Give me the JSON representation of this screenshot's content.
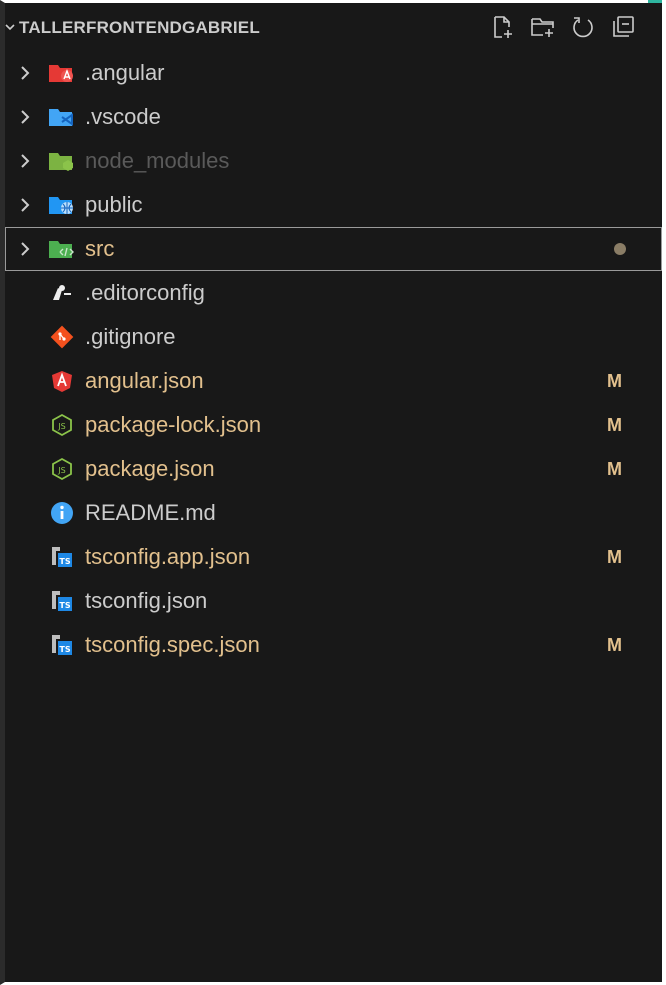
{
  "explorer": {
    "title": "TALLERFRONTENDGABRIEL",
    "actions": [
      {
        "name": "new-file-icon"
      },
      {
        "name": "new-folder-icon"
      },
      {
        "name": "refresh-icon"
      },
      {
        "name": "collapse-all-icon"
      }
    ]
  },
  "colors": {
    "background": "#181818",
    "text": "#cccccc",
    "muted": "#7f7f7f",
    "modified": "#e2c08d",
    "ignored": "#5a5a5a"
  },
  "tree": [
    {
      "label": ".angular",
      "kind": "folder",
      "icon": "angular-folder-icon",
      "color": "#cccccc"
    },
    {
      "label": ".vscode",
      "kind": "folder",
      "icon": "vscode-folder-icon",
      "color": "#cccccc"
    },
    {
      "label": "node_modules",
      "kind": "folder",
      "icon": "node-folder-icon",
      "color": "#5a5a5a"
    },
    {
      "label": "public",
      "kind": "folder",
      "icon": "public-folder-icon",
      "color": "#cccccc"
    },
    {
      "label": "src",
      "kind": "folder",
      "icon": "src-folder-icon",
      "color": "#e2c08d",
      "selected": true,
      "dot": true
    },
    {
      "label": ".editorconfig",
      "kind": "file",
      "icon": "editorconfig-icon",
      "color": "#cccccc"
    },
    {
      "label": ".gitignore",
      "kind": "file",
      "icon": "git-icon",
      "color": "#cccccc"
    },
    {
      "label": "angular.json",
      "kind": "file",
      "icon": "angular-icon",
      "color": "#e2c08d",
      "badge": "M"
    },
    {
      "label": "package-lock.json",
      "kind": "file",
      "icon": "nodejs-icon",
      "color": "#e2c08d",
      "badge": "M"
    },
    {
      "label": "package.json",
      "kind": "file",
      "icon": "nodejs-icon",
      "color": "#e2c08d",
      "badge": "M"
    },
    {
      "label": "README.md",
      "kind": "file",
      "icon": "info-icon",
      "color": "#cccccc"
    },
    {
      "label": "tsconfig.app.json",
      "kind": "file",
      "icon": "tsconfig-icon",
      "color": "#e2c08d",
      "badge": "M"
    },
    {
      "label": "tsconfig.json",
      "kind": "file",
      "icon": "tsconfig-icon",
      "color": "#cccccc"
    },
    {
      "label": "tsconfig.spec.json",
      "kind": "file",
      "icon": "tsconfig-icon",
      "color": "#e2c08d",
      "badge": "M"
    }
  ]
}
